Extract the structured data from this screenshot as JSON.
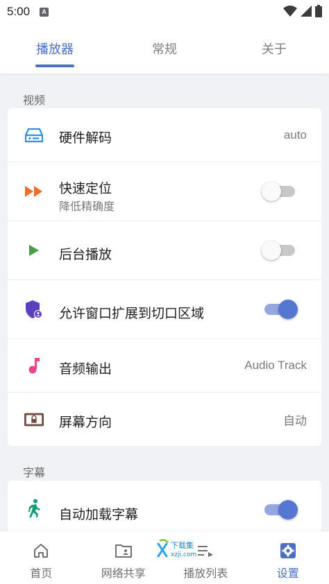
{
  "status": {
    "time": "5:00",
    "notification_letter": "A"
  },
  "tabs": [
    {
      "label": "播放器",
      "active": true
    },
    {
      "label": "常规",
      "active": false
    },
    {
      "label": "关于",
      "active": false
    }
  ],
  "sections": {
    "video": {
      "title": "视频",
      "rows": [
        {
          "title": "硬件解码",
          "value": "auto",
          "icon": "hardware-decode-icon",
          "icon_color": "#2f8fe0"
        },
        {
          "title": "快速定位",
          "subtitle": "降低精确度",
          "switch_on": false,
          "icon": "fast-forward-icon",
          "icon_color": "#f26b2e"
        },
        {
          "title": "后台播放",
          "switch_on": false,
          "icon": "play-icon",
          "icon_color": "#43a047"
        },
        {
          "title": "允许窗口扩展到切口区域",
          "switch_on": true,
          "icon": "shield-user-icon",
          "icon_color": "#5b3fbf"
        },
        {
          "title": "音频输出",
          "value": "Audio Track",
          "icon": "music-note-icon",
          "icon_color": "#e94588"
        },
        {
          "title": "屏幕方向",
          "value": "自动",
          "icon": "screen-rotation-icon",
          "icon_color": "#6d4c41"
        }
      ]
    },
    "subtitles": {
      "title": "字幕",
      "rows": [
        {
          "title": "自动加载字幕",
          "switch_on": true,
          "icon": "walking-icon",
          "icon_color": "#179b7b"
        }
      ]
    }
  },
  "bottom_nav": [
    {
      "label": "首页",
      "icon": "home-icon",
      "active": false
    },
    {
      "label": "网络共享",
      "icon": "shared-folder-icon",
      "active": false
    },
    {
      "label": "播放列表",
      "icon": "playlist-icon",
      "active": false
    },
    {
      "label": "设置",
      "icon": "settings-icon",
      "active": true
    }
  ],
  "watermark": {
    "text": "下载集",
    "domain": "xzji.com"
  },
  "colors": {
    "accent": "#4a6fc0",
    "switch_on_thumb": "#5577d2",
    "background": "#f1f2f5"
  }
}
